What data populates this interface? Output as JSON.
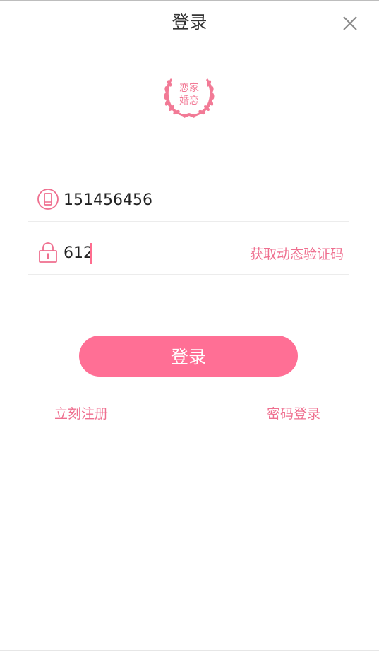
{
  "header": {
    "title": "登录"
  },
  "logo": {
    "line1": "恋家",
    "line2": "婚恋"
  },
  "form": {
    "phone_value": "151456456",
    "code_value": "612",
    "get_code_label": "获取动态验证码"
  },
  "actions": {
    "login_label": "登录",
    "register_label": "立刻注册",
    "password_login_label": "密码登录"
  },
  "icons": {
    "close": "close-icon",
    "phone": "phone-icon",
    "lock": "lock-icon",
    "logo": "laurel-logo"
  },
  "colors": {
    "accent": "#ff6f95",
    "accent_text": "#ef6f8f"
  }
}
